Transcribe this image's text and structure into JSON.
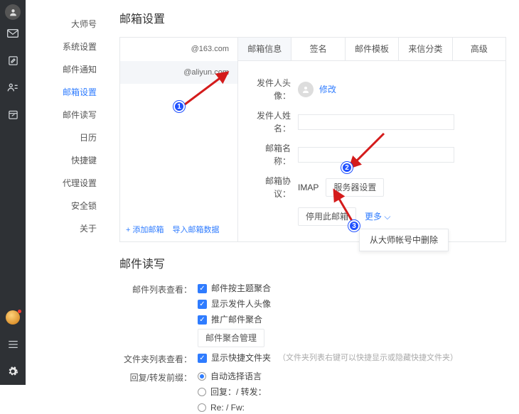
{
  "rail": {
    "top": "user-icon",
    "icons": [
      "mail-icon",
      "compose-icon",
      "contacts-icon",
      "calendar-icon"
    ],
    "bottom": [
      "coin-icon",
      "menu-icon",
      "gear-icon"
    ]
  },
  "nav": {
    "items": [
      "大师号",
      "系统设置",
      "邮件通知",
      "邮箱设置",
      "邮件读写",
      "日历",
      "快捷键",
      "代理设置",
      "安全锁",
      "关于"
    ],
    "active_index": 3
  },
  "mailbox": {
    "title": "邮箱设置",
    "accounts": [
      "@163.com",
      "@aliyun.com"
    ],
    "selected_index": 1,
    "add_label": "+ 添加邮箱",
    "import_label": "导入邮箱数据",
    "tabs": [
      "邮箱信息",
      "签名",
      "邮件模板",
      "来信分类",
      "高级"
    ],
    "active_tab": 0,
    "rows": {
      "avatar_label": "发件人头像：",
      "avatar_action": "修改",
      "name_label": "发件人姓名：",
      "name_value": "",
      "box_label": "邮箱名称：",
      "box_value": "",
      "proto_label": "邮箱协议：",
      "proto_value": "IMAP",
      "server_btn": "服务器设置",
      "disable_btn": "停用此邮箱",
      "more_btn": "更多",
      "more_caret": "⌵",
      "dropdown_item": "从大师帐号中删除"
    }
  },
  "read": {
    "title": "邮件读写",
    "list_label": "邮件列表查看：",
    "list_opts": [
      "邮件按主题聚合",
      "显示发件人头像",
      "推广邮件聚合"
    ],
    "list_manage_btn": "邮件聚合管理",
    "folder_label": "文件夹列表查看：",
    "folder_opt": "显示快捷文件夹",
    "folder_hint": "（文件夹列表右键可以快捷显示或隐藏快捷文件夹）",
    "reply_label": "回复/转发前缀：",
    "reply_opts": [
      "自动选择语言",
      "回复：/ 转发：",
      "Re: / Fw:"
    ],
    "reply_selected": 0
  },
  "annotations": {
    "1": "1",
    "2": "2",
    "3": "3"
  }
}
